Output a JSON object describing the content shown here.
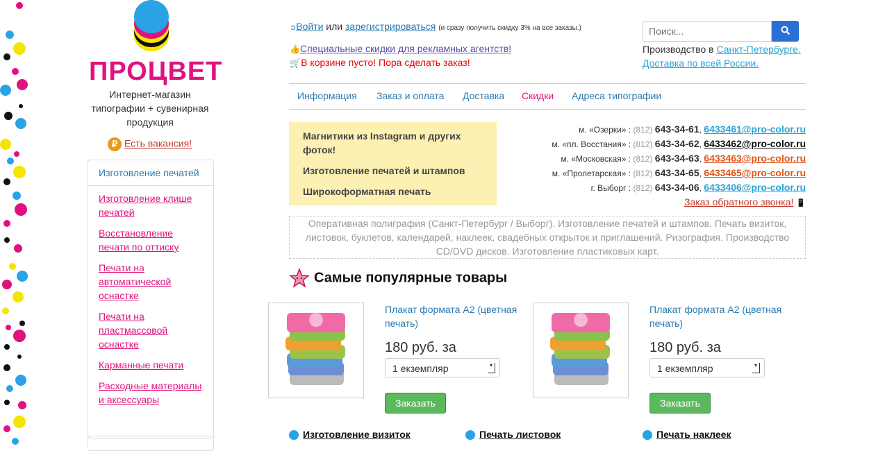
{
  "colors": {
    "brand": "#e0127f",
    "link": "#2a7ab0",
    "search_button": "#2a6fd4",
    "order_button": "#5cb85c",
    "promo_bg": "#fdf0b3"
  },
  "logo": {
    "name": "ПРОЦВЕТ",
    "tagline": "Интернет-магазин типографии + сувенирная продукция"
  },
  "vacancy": {
    "icon": "ruble-icon",
    "icon_glyph": "₽",
    "text": "Есть вакансия!"
  },
  "sidebar": {
    "heading": "Изготовление печатей",
    "items": [
      {
        "label": "Изготовление клише печатей"
      },
      {
        "label": "Восстановление печати по оттиску"
      },
      {
        "label": "Печати на автоматической оснастке"
      },
      {
        "label": "Печати на пластмассовой оснастке"
      },
      {
        "label": "Карманные печати"
      },
      {
        "label": "Расходные материалы и аксессуары"
      }
    ]
  },
  "header": {
    "login": "Войти",
    "or": "или",
    "register": "зарегистрироваться",
    "register_note": "(и сразу получить скидку 3% на все заказы.)",
    "special": "Специальные скидки для рекламных агентств!",
    "cart": "В корзине пусто! Пора сделать заказ!"
  },
  "search": {
    "placeholder": "Поиск...",
    "icon": "search-icon"
  },
  "city": {
    "prefix": "Производство в",
    "city_link": "Санкт-Петербурге.",
    "delivery": "Доставка по всей России."
  },
  "nav": [
    {
      "label": "Информация",
      "color": "#2a7ab0"
    },
    {
      "label": "Заказ и оплата",
      "color": "#2a7ab0"
    },
    {
      "label": "Доставка",
      "color": "#2a7ab0"
    },
    {
      "label": "Скидки",
      "color": "#e0127f"
    },
    {
      "label": "Адреса типографии",
      "color": "#2a7ab0"
    }
  ],
  "promo": [
    "Магнитики из Instagram и других фоток!",
    "Изготовление печатей и штампов",
    "Широкоформатная печать"
  ],
  "contacts": [
    {
      "metro": "м. «Озерки» :",
      "code": "(812)",
      "phone": "643-34-61",
      "email": "6433461@pro-color.ru",
      "color": "#2aa3d6"
    },
    {
      "metro": "м. «пл. Восстания» :",
      "code": "(812)",
      "phone": "643-34-62",
      "email": "6433462@pro-color.ru",
      "color": "#111111"
    },
    {
      "metro": "м. «Московская» :",
      "code": "(812)",
      "phone": "643-34-63",
      "email": "6433463@pro-color.ru",
      "color": "#e0561a"
    },
    {
      "metro": "м. «Пролетарская» :",
      "code": "(812)",
      "phone": "643-34-65",
      "email": "6433465@pro-color.ru",
      "color": "#e0561a"
    },
    {
      "metro": "г. Выборг :",
      "code": "(812)",
      "phone": "643-34-06",
      "email": "6433406@pro-color.ru",
      "color": "#2aa3d6"
    }
  ],
  "callback": "Заказ обратного звонка!",
  "description": "Оперативная полиграфия (Санкт-Петербург / Выборг). Изготовление печатей и штампов. Печать визиток, листовок, буклетов, календарей, наклеек, свадебных открыток и приглашений. Ризография. Производство CD/DVD дисков. Изготовление пластиковых карт.",
  "popular": {
    "title": "Самые популярные товары",
    "products": [
      {
        "title": "Плакат формата А2 (цветная печать)",
        "price": "180 руб. за",
        "option": "1 екземпляр",
        "button": "Заказать"
      },
      {
        "title": "Плакат формата А2 (цветная печать)",
        "price": "180 руб. за",
        "option": "1 екземпляр",
        "button": "Заказать"
      }
    ]
  },
  "bottom_links": [
    {
      "label": "Изготовление визиток"
    },
    {
      "label": "Печать листовок"
    },
    {
      "label": "Печать наклеек"
    }
  ]
}
